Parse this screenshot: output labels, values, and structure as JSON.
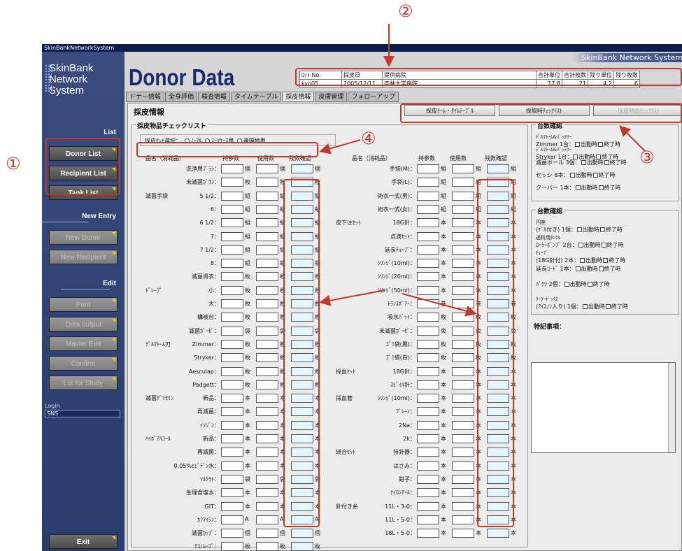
{
  "window_title": "SkinBankNetworkSystem",
  "circles": [
    "②",
    "①",
    "④",
    "③"
  ],
  "logo": [
    "SkinBank",
    "Network",
    "System"
  ],
  "brand_top": "SkinBank Network System",
  "page_title": "Donor Data",
  "info_headers": [
    "ﾛｯﾄ No.",
    "採皮日",
    "提供病院",
    "合計単位",
    "合計枚数",
    "残り単位",
    "残り枚数"
  ],
  "info_values": [
    "kyo05",
    "2005/12/11",
    "杏林大学病院",
    "17.8",
    "21",
    "4.2",
    "6"
  ],
  "sidebar": {
    "list_label": "List",
    "list": [
      "Donor List",
      "Recipient List",
      "Tank List"
    ],
    "new_label": "New Entry",
    "new": [
      "New Donor",
      "New Recipient"
    ],
    "edit_label": "Edit",
    "edit": [
      "Print",
      "Data output",
      "Master Edit",
      "Confirm",
      "Lot for Study"
    ],
    "login_label": "Login",
    "login_value": "SNS",
    "exit": "Exit"
  },
  "tabs": [
    "ドナー情報",
    "全身評価",
    "検査情報",
    "タイムテーブル",
    "採皮情報",
    "皮膚管理",
    "フォローアップ"
  ],
  "pane_title": "採皮情報",
  "top_buttons": [
    "採皮ﾁｰﾑ・ﾀｲﾑﾃｰﾌﾞﾙ",
    "採取時ﾁｪｯｸﾘｽﾄ",
    "採皮物品ﾁｪｯｸﾘｽﾄ"
  ],
  "checklist_title": "採皮物品チェックリスト",
  "set_select": "採皮ｾｯﾄ選択：",
  "radios": [
    "ﾉｰﾏﾙ",
    "ｽｰﾂｹｰｽ用",
    "遠隔地用"
  ],
  "col_headers": [
    "品名（消耗品）",
    "持参数",
    "使用数",
    "残数確認"
  ],
  "left_rows": [
    [
      "",
      "洗浄用ﾌﾞﾗｼ：",
      "個"
    ],
    [
      "",
      "未滅菌ｶﾞｳﾝ：",
      "枚"
    ],
    [
      "滅菌手袋",
      "5 1/2：",
      "組"
    ],
    [
      "",
      "6：",
      "組"
    ],
    [
      "",
      "6 1/2：",
      "組"
    ],
    [
      "",
      "7：",
      "組"
    ],
    [
      "",
      "7 1/2：",
      "組"
    ],
    [
      "",
      "8：",
      "組"
    ],
    [
      "",
      "滅菌資衣：",
      "枚"
    ],
    [
      "ﾄﾞﾚｰﾌﾟ",
      "小：",
      "枚"
    ],
    [
      "",
      "大：",
      "枚"
    ],
    [
      "",
      "構被台：",
      "枚"
    ],
    [
      "",
      "滅菌ｶﾞｰｾﾞ：",
      "袋"
    ],
    [
      "ﾃﾞﾙﾏﾄｰﾑ刃",
      "Zimmer：",
      "枚"
    ],
    [
      "",
      "Stryker：",
      "枚"
    ],
    [
      "",
      "Aesculap：",
      "枚"
    ],
    [
      "",
      "Padgett：",
      "枚"
    ],
    [
      "滅菌ｸﾞﾘｾﾘﾝ",
      "新品：",
      "本"
    ],
    [
      "",
      "再滅菌：",
      "本"
    ],
    [
      "",
      "ｲｿｼﾞﾝ：",
      "本"
    ],
    [
      "ﾊｲﾎﾟｱﾙｺｰﾙ",
      "新品：",
      "本"
    ],
    [
      "",
      "再滅菌：",
      "本"
    ],
    [
      "",
      "0.05%ﾋﾋﾞﾃﾞﾝ水：",
      "本"
    ],
    [
      "",
      "ｿﾙｸﾗﾄ：",
      "袋"
    ],
    [
      "",
      "生理食塩水：",
      "本"
    ],
    [
      "",
      "GIT：",
      "本"
    ],
    [
      "",
      "ｶﾌﾏｲｼﾝ：",
      "A"
    ],
    [
      "",
      "滅菌ｶｯﾌﾟ：",
      "個"
    ],
    [
      "",
      "ﾃｺﾉﾑｰﾌﾞ：",
      "枚"
    ]
  ],
  "right_rows": [
    [
      "",
      "手袋(M)：",
      "組"
    ],
    [
      "",
      "手袋(L)：",
      "組"
    ],
    [
      "",
      "術衣一式(男)：",
      "組"
    ],
    [
      "",
      "術衣一式(女)：",
      "組"
    ],
    [
      "皮下注ｾｯﾄ",
      "18G針：",
      "本"
    ],
    [
      "",
      "点滴ｾｯﾄ：",
      "本"
    ],
    [
      "",
      "延長ﾁｭｰﾌﾞ：",
      "本"
    ],
    [
      "",
      "ｼﾘﾝｼﾞ(10ml)：",
      "本"
    ],
    [
      "",
      "ｼﾘﾝｼﾞ(20ml)：",
      "本"
    ],
    [
      "",
      "ｼﾘﾝｼﾞ(50ml)：",
      "本"
    ],
    [
      "",
      "ﾄﾗﾝｽﾎﾟｱｰ：",
      "巻"
    ],
    [
      "",
      "吸水ﾊﾟｯﾄ：",
      "枚"
    ],
    [
      "",
      "未滅菌ｶﾞｰｾﾞ：",
      "束"
    ],
    [
      "",
      "ｺﾞﾐ袋(黒)：",
      "枚"
    ],
    [
      "",
      "ｺﾞﾐ袋(白)：",
      "枚"
    ],
    [
      "採血ｾｯﾄ",
      "18G針：",
      "本"
    ],
    [
      "",
      "ｽﾋﾟｲﾙ針：",
      "本"
    ],
    [
      "採血管",
      "ｼﾘﾝｼﾞ(10ml)：",
      "本"
    ],
    [
      "",
      "ﾌﾟﾚｰﾝ：",
      "本"
    ],
    [
      "",
      "2Na：",
      "本"
    ],
    [
      "",
      "2k：",
      "本"
    ],
    [
      "縫合ｾｯﾄ",
      "持針器：",
      "本"
    ],
    [
      "",
      "はさみ：",
      "本"
    ],
    [
      "",
      "鉗子：",
      "本"
    ],
    [
      "",
      "ﾅｲﾛﾝﾃｰﾙ：",
      "本"
    ],
    [
      "針付き糸",
      "11L・3-0：",
      "本"
    ],
    [
      "",
      "11L・5-0：",
      "本"
    ],
    [
      "",
      "18L・5-0：",
      "本"
    ]
  ],
  "count1_title": "台数確認",
  "count1": [
    [
      "ﾃﾞﾙﾏﾄｰﾑ&ﾊﾞｯﾃﾘｰ",
      "Zimmer 1台："
    ],
    [
      "ﾃﾞﾙﾏﾄｰﾑ&ﾊﾞｯﾃﾘｰ",
      "Stryker 1台："
    ],
    [
      "",
      "滅菌ボール 3個："
    ],
    [
      "",
      "セッシ 8本："
    ],
    [
      "",
      "クーパー 1本："
    ]
  ],
  "count2_title": "台数確認",
  "count2": [
    [
      "円座",
      "(ｹﾞﾙ付き) 1個："
    ],
    [
      "透析用ﾀﾝｸﾙ",
      "ﾛｰﾗｰﾎﾟﾝﾌﾟ 2台："
    ],
    [
      "ﾁｭｰﾌﾞ",
      "(18G針付) 2本："
    ],
    [
      "",
      "延長ｺｰﾄﾞ 1本："
    ],
    [
      "",
      "ﾊﾞｹﾂ 2個："
    ],
    [
      "ｸｰﾗｰﾎﾞｯｸｽ",
      "(ｱｲｽﾉﾝ入り) 1個："
    ]
  ],
  "chk_out": "出動時",
  "chk_end": "終了時",
  "notes_label": "特記事項："
}
